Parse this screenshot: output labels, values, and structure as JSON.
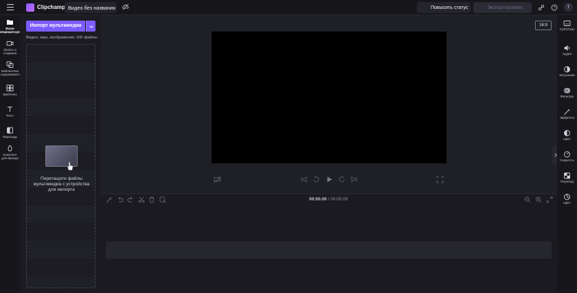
{
  "header": {
    "app_name": "Clipchamp",
    "project_title": "Видео без названия",
    "upgrade_label": "Повысить статус",
    "export_label": "Экспортировать",
    "avatar_initial": "Т"
  },
  "left_nav": {
    "items": [
      {
        "label": "Ваши медиаресурсы",
        "icon": "folder-icon"
      },
      {
        "label": "Запись и создание",
        "icon": "camera-icon"
      },
      {
        "label": "Библиотека содержимого",
        "icon": "library-icon"
      },
      {
        "label": "Шаблоны",
        "icon": "templates-icon"
      },
      {
        "label": "Текст",
        "icon": "text-icon"
      },
      {
        "label": "Переходы",
        "icon": "transitions-icon"
      },
      {
        "label": "Комплект для бренда",
        "icon": "brand-kit-icon"
      }
    ]
  },
  "media_panel": {
    "import_label": "Импорт мультимедиа",
    "hint": "Видео, звук, изображения, GIF-файлы",
    "drop_text": "Перетащите файлы мультимедиа с устройства для импорта"
  },
  "stage": {
    "aspect_ratio": "16:9"
  },
  "timeline": {
    "current_time": "00:00.00",
    "separator": " / ",
    "total_time": "00:00.00"
  },
  "right_nav": {
    "items": [
      {
        "label": "Субтитры",
        "icon": "captions-icon"
      },
      {
        "label": "Аудио",
        "icon": "speaker-icon"
      },
      {
        "label": "Затухание",
        "icon": "fade-icon"
      },
      {
        "label": "Фильтры",
        "icon": "filters-icon"
      },
      {
        "label": "Эффекты",
        "icon": "effects-icon"
      },
      {
        "label": "Цвет",
        "icon": "color-icon"
      },
      {
        "label": "Скорость",
        "icon": "speed-icon"
      },
      {
        "label": "Переход",
        "icon": "transition-icon"
      },
      {
        "label": "Цвет",
        "icon": "color-wheel-icon"
      }
    ]
  },
  "colors": {
    "accent": "#7c5cff",
    "background": "#1f1f26",
    "panel": "#16161b",
    "preview": "#000000"
  }
}
